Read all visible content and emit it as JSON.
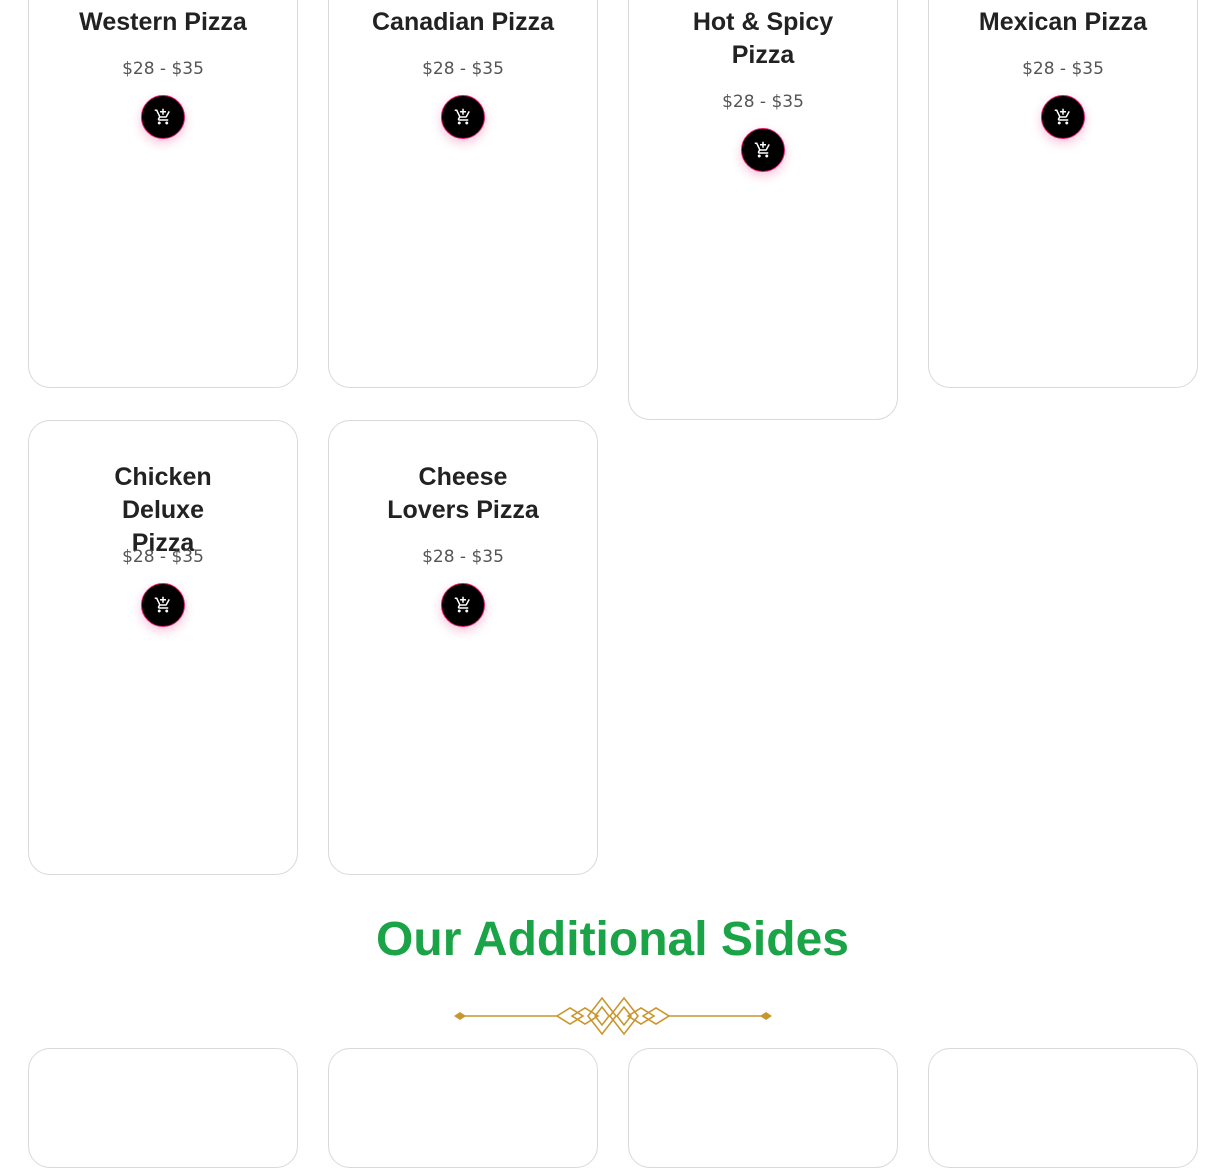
{
  "products": [
    {
      "name": "Western Pizza",
      "price": "$28 - $35",
      "add_to_cart_icon": "add-to-cart-icon"
    },
    {
      "name": "Canadian Pizza",
      "price": "$28 - $35",
      "add_to_cart_icon": "add-to-cart-icon"
    },
    {
      "name": "Hot & Spicy Pizza",
      "price": "$28 - $35",
      "add_to_cart_icon": "add-to-cart-icon"
    },
    {
      "name": "Mexican Pizza",
      "price": "$28 - $35",
      "add_to_cart_icon": "add-to-cart-icon"
    },
    {
      "name": "Chicken Deluxe Pizza",
      "price": "$28 - $35",
      "add_to_cart_icon": "add-to-cart-icon"
    },
    {
      "name": "Cheese Lovers Pizza",
      "price": "$28 - $35",
      "add_to_cart_icon": "add-to-cart-icon"
    }
  ],
  "sides_section": {
    "title": "Our Additional Sides",
    "ornament_icon": "gold-divider-ornament"
  },
  "colors": {
    "section_title": "#1ba347",
    "cart_button_bg": "#000000",
    "cart_button_border": "#e3166d",
    "ornament": "#c9962e",
    "card_border": "#d9d9d9"
  }
}
